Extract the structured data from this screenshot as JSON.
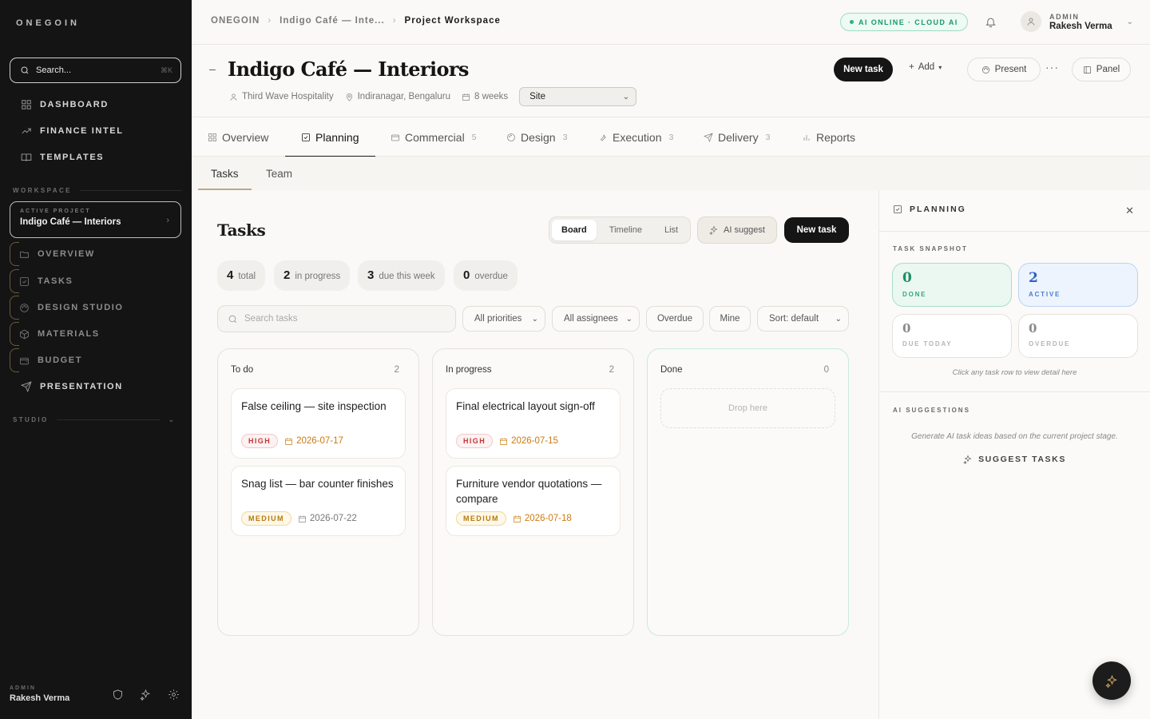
{
  "app": {
    "brand": "ONEGOIN"
  },
  "sidebar": {
    "search_placeholder": "Search...",
    "search_shortcut": "⌘K",
    "items": [
      {
        "label": "DASHBOARD",
        "icon": "grid-icon"
      },
      {
        "label": "FINANCE INTEL",
        "icon": "trend-icon"
      },
      {
        "label": "TEMPLATES",
        "icon": "book-icon"
      }
    ],
    "workspace_label": "WORKSPACE",
    "active_project_label": "ACTIVE PROJECT",
    "active_project_name": "Indigo Café — Interiors",
    "project_items": [
      {
        "label": "OVERVIEW",
        "icon": "folder-icon"
      },
      {
        "label": "TASKS",
        "icon": "checkbox-icon"
      },
      {
        "label": "DESIGN STUDIO",
        "icon": "palette-icon"
      },
      {
        "label": "MATERIALS",
        "icon": "box-icon"
      },
      {
        "label": "BUDGET",
        "icon": "wallet-icon"
      }
    ],
    "presentation_label": "PRESENTATION",
    "studio_label": "STUDIO",
    "footer": {
      "role": "ADMIN",
      "name": "Rakesh Verma"
    }
  },
  "topbar": {
    "breadcrumbs": [
      "ONEGOIN",
      "Indigo Café — Inte...",
      "Project Workspace"
    ],
    "ai_status": "AI ONLINE · CLOUD AI",
    "user_role": "ADMIN",
    "user_name": "Rakesh Verma"
  },
  "project": {
    "title": "Indigo Café — Interiors",
    "client": "Third Wave Hospitality",
    "location": "Indiranagar, Bengaluru",
    "duration": "8 weeks",
    "stage": "Site",
    "new_task_label": "New task",
    "add_label": "Add",
    "present_label": "Present",
    "more_label": "···",
    "panel_label": "Panel"
  },
  "tabs": [
    {
      "label": "Overview",
      "count": ""
    },
    {
      "label": "Planning",
      "count": ""
    },
    {
      "label": "Commercial",
      "count": "5"
    },
    {
      "label": "Design",
      "count": "3"
    },
    {
      "label": "Execution",
      "count": "3"
    },
    {
      "label": "Delivery",
      "count": "3"
    },
    {
      "label": "Reports",
      "count": ""
    }
  ],
  "subtabs": [
    "Tasks",
    "Team"
  ],
  "tasks": {
    "title": "Tasks",
    "views": [
      "Board",
      "Timeline",
      "List"
    ],
    "ai_suggest_label": "AI suggest",
    "new_task_label": "New task",
    "stats": [
      {
        "value": "4",
        "label": "total"
      },
      {
        "value": "2",
        "label": "in progress"
      },
      {
        "value": "3",
        "label": "due this week"
      },
      {
        "value": "0",
        "label": "overdue"
      }
    ],
    "search_placeholder": "Search tasks",
    "filters": {
      "priority": "All priorities",
      "assignee": "All assignees",
      "overdue": "Overdue",
      "mine": "Mine",
      "sort": "Sort: default"
    },
    "columns": [
      {
        "name": "To do",
        "count": "2",
        "cards": [
          {
            "title": "False ceiling — site inspection",
            "priority": "HIGH",
            "due": "2026-07-17"
          },
          {
            "title": "Snag list — bar counter finishes",
            "priority": "MEDIUM",
            "due": "2026-07-22"
          }
        ]
      },
      {
        "name": "In progress",
        "count": "2",
        "cards": [
          {
            "title": "Final electrical layout sign-off",
            "priority": "HIGH",
            "due": "2026-07-15"
          },
          {
            "title": "Furniture vendor quotations — compare",
            "priority": "MEDIUM",
            "due": "2026-07-18"
          }
        ]
      },
      {
        "name": "Done",
        "count": "0",
        "drop_label": "Drop here",
        "cards": []
      }
    ]
  },
  "panel": {
    "title": "PLANNING",
    "snapshot_label": "TASK SNAPSHOT",
    "snapshot": [
      {
        "value": "0",
        "label": "DONE"
      },
      {
        "value": "2",
        "label": "ACTIVE"
      },
      {
        "value": "0",
        "label": "DUE TODAY"
      },
      {
        "value": "0",
        "label": "OVERDUE"
      }
    ],
    "hint": "Click any task row to view detail here",
    "ai_label": "AI SUGGESTIONS",
    "ai_hint": "Generate AI task ideas based on the current project stage.",
    "suggest_label": "SUGGEST TASKS"
  },
  "colors": {
    "accent_dark": "#151515",
    "ai_green": "#17996a",
    "high": "#c2363a",
    "medium": "#b7790e",
    "active_blue": "#2f63c3"
  }
}
